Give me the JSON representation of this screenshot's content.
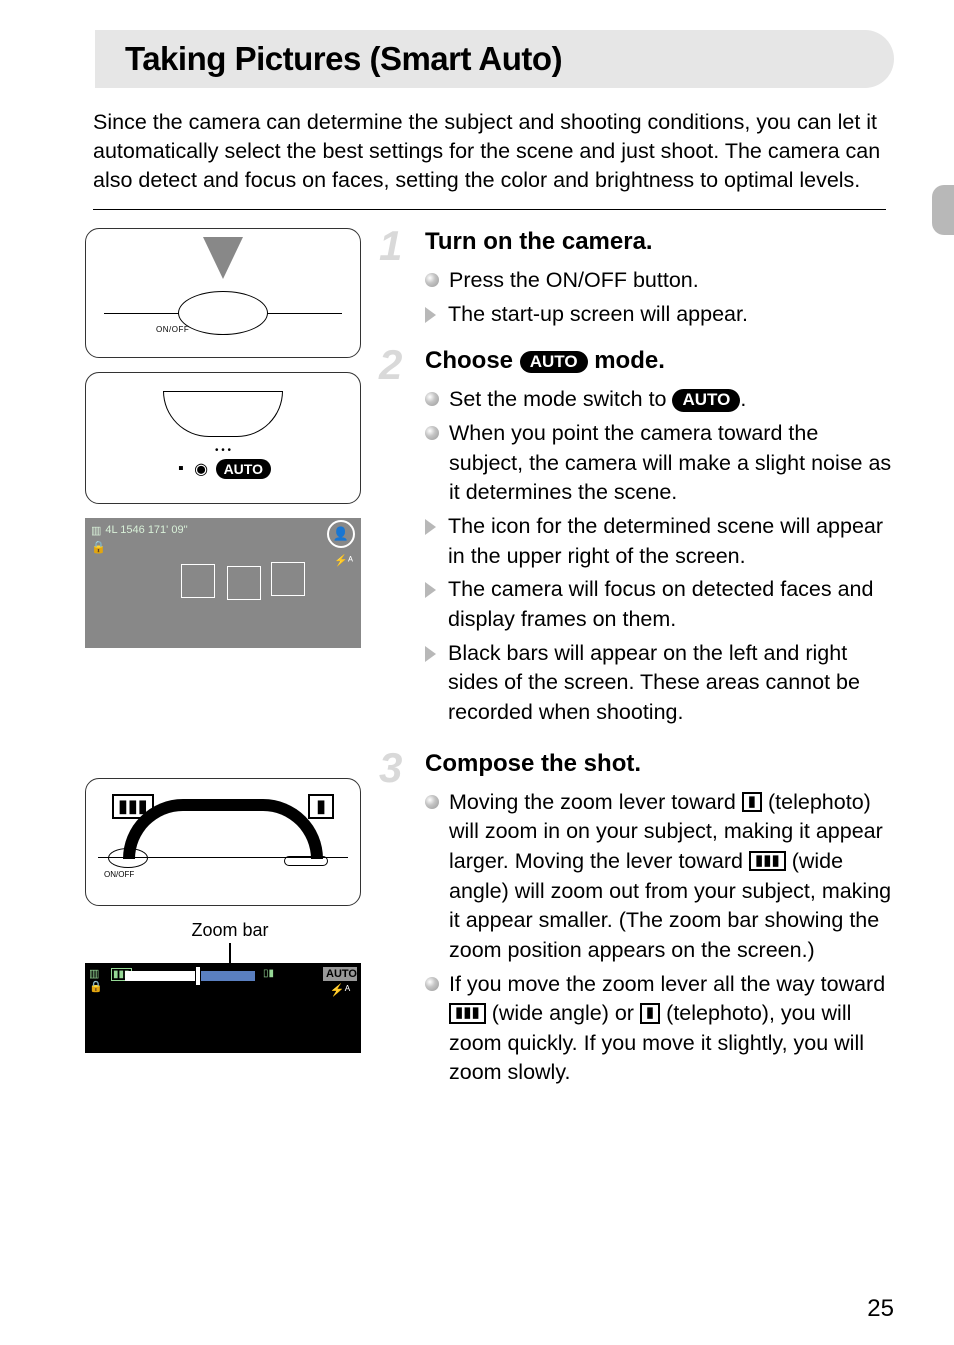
{
  "page_number": "25",
  "title": "Taking Pictures (Smart Auto)",
  "intro": "Since the camera can determine the subject and shooting conditions, you can let it automatically select the best settings for the scene and just shoot. The camera can also detect and focus on faces, setting the color and brightness to optimal levels.",
  "zoom_bar_label": "Zoom bar",
  "auto_label": "AUTO",
  "illus1": {
    "onoff": "ON/OFF"
  },
  "illus3": {
    "status": "4L  1546    171' 09''"
  },
  "illus4": {
    "onoff": "ON/OFF",
    "wa": "▮▮▮",
    "tele": "▮"
  },
  "illus5": {
    "auto": "AUTO"
  },
  "steps": {
    "s1": {
      "num": "1",
      "title": "Turn on the camera.",
      "a": "Press the ON/OFF button.",
      "b": "The start-up screen will appear."
    },
    "s2": {
      "num": "2",
      "title_a": "Choose ",
      "title_b": " mode.",
      "a_pre": "Set the mode switch to ",
      "a_post": ".",
      "b": "When you point the camera toward the subject, the camera will make a slight noise as it determines the scene.",
      "c": "The icon for the determined scene will appear in the upper right of the screen.",
      "d": "The camera will focus on detected faces and display frames on them.",
      "e": "Black bars will appear on the left and right sides of the screen. These areas cannot be recorded when shooting."
    },
    "s3": {
      "num": "3",
      "title": "Compose the shot.",
      "a_1": "Moving the zoom lever toward ",
      "a_2": " (telephoto) will zoom in on your subject, making it appear larger. Moving the lever toward ",
      "a_3": " (wide angle) will zoom out from your subject, making it appear smaller. (The zoom bar showing the zoom position appears on the screen.)",
      "b_1": "If you move the zoom lever all the way toward ",
      "b_2": " (wide angle) or ",
      "b_3": " (telephoto), you will zoom quickly. If you move it slightly, you will zoom slowly."
    }
  }
}
